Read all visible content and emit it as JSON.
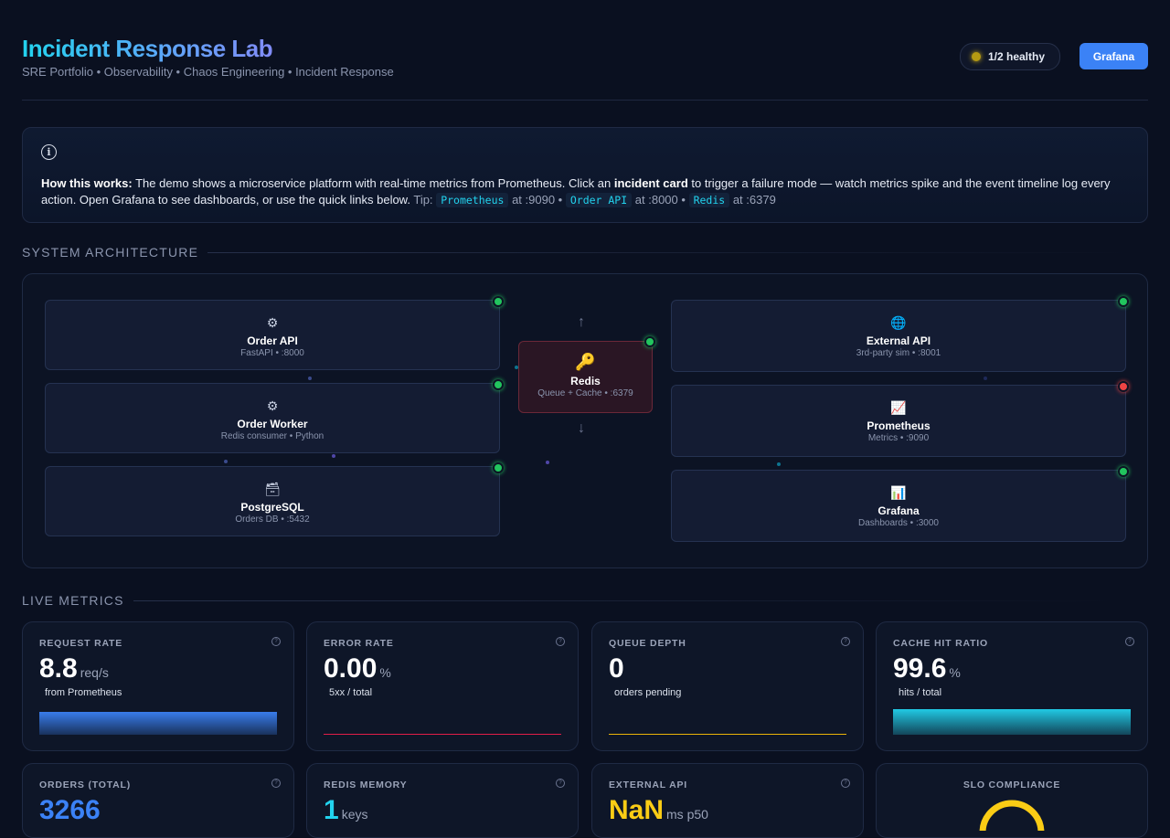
{
  "header": {
    "title": "Incident Response Lab",
    "subtitle": "SRE Portfolio • Observability • Chaos Engineering • Incident Response",
    "health_status": "1/2 healthy",
    "grafana_button": "Grafana"
  },
  "info": {
    "lead": "How this works:",
    "text1": "The demo shows a microservice platform with real-time metrics from Prometheus. Click an",
    "bold2": "incident card",
    "text2": "to trigger a failure mode — watch metrics spike and the event timeline log every action. Open Grafana to see dashboards, or use the quick links below.",
    "tip": "Tip:",
    "link1": "Prometheus",
    "port1": "at :9090 •",
    "link2": "Order API",
    "port2": "at :8000 •",
    "link3": "Redis",
    "port3": "at :6379"
  },
  "architecture": {
    "heading": "SYSTEM ARCHITECTURE",
    "left_nodes": [
      {
        "icon": "⚙",
        "name": "Order API",
        "sub": "FastAPI • :8000",
        "status": "healthy"
      },
      {
        "icon": "⚙",
        "name": "Order Worker",
        "sub": "Redis consumer • Python",
        "status": "healthy"
      },
      {
        "icon": "🗃",
        "name": "PostgreSQL",
        "sub": "Orders DB • :5432",
        "status": "healthy"
      }
    ],
    "center_node": {
      "icon": "🔑",
      "name": "Redis",
      "sub": "Queue + Cache • :6379",
      "status": "healthy"
    },
    "right_nodes": [
      {
        "icon": "🌐",
        "name": "External API",
        "sub": "3rd-party sim • :8001",
        "status": "healthy"
      },
      {
        "icon": "📈",
        "name": "Prometheus",
        "sub": "Metrics • :9090",
        "status": "down"
      },
      {
        "icon": "📊",
        "name": "Grafana",
        "sub": "Dashboards • :3000",
        "status": "healthy"
      }
    ],
    "arrow_up": "↑",
    "arrow_down": "↓"
  },
  "metrics": {
    "heading": "LIVE METRICS",
    "cards": [
      {
        "label": "REQUEST RATE",
        "value": "8.8",
        "unit": "req/s",
        "desc": "from Prometheus",
        "bar_level": 0.9,
        "bar_color": "#3b82f6"
      },
      {
        "label": "ERROR RATE",
        "value": "0.00",
        "unit": "%",
        "desc": "5xx / total",
        "bar_level": 0.0,
        "bar_color": "#e11d48"
      },
      {
        "label": "QUEUE DEPTH",
        "value": "0",
        "unit": "",
        "desc": "orders pending",
        "bar_level": 0.0,
        "bar_color": "#eab308"
      },
      {
        "label": "CACHE HIT RATIO",
        "value": "99.6",
        "unit": "%",
        "desc": "hits / total",
        "bar_level": 0.996,
        "bar_color": "#22d3ee"
      }
    ],
    "cards2": [
      {
        "label": "ORDERS (TOTAL)",
        "value": "3266",
        "unit": "",
        "value_color": "#3b82f6"
      },
      {
        "label": "REDIS MEMORY",
        "value": "1",
        "unit": "keys",
        "value_color": "#22d3ee"
      },
      {
        "label": "EXTERNAL API",
        "value": "NaN",
        "unit": "ms p50",
        "value_color": "#facc15"
      },
      {
        "label": "SLO COMPLIANCE",
        "value": "",
        "unit": "",
        "value_color": "#facc15"
      }
    ]
  },
  "colors": {
    "accent": "#3b82f6",
    "healthy": "#22c55e",
    "down": "#ef4444",
    "warning": "#d4b41a"
  }
}
